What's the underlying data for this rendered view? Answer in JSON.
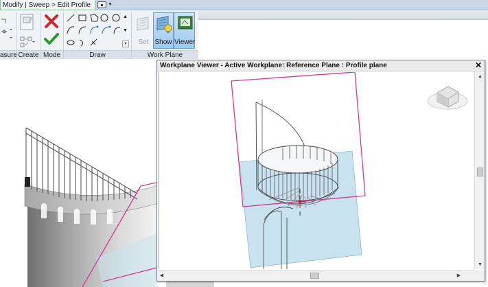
{
  "tab_bar": {
    "context_tab": "Modify | Sweep > Edit Profile"
  },
  "ribbon": {
    "groups": {
      "measure": "asure",
      "create": "Create",
      "mode": "Mode",
      "draw": "Draw",
      "work_plane": "Work Plane"
    },
    "buttons": {
      "set": "Set",
      "show": "Show",
      "viewer": "Viewer"
    }
  },
  "viewer": {
    "title": "Workplane Viewer - Active Workplane: Reference Plane : Profile plane",
    "close": "✕"
  },
  "colors": {
    "reference_plane": "#d0398f",
    "workplane_fill": "#c8e2f0",
    "ribbon_accent": "#8fbf9e",
    "active_button": "#9ec9ed",
    "finish_check": "#2e9a2e",
    "cancel_x": "#d0262b"
  }
}
